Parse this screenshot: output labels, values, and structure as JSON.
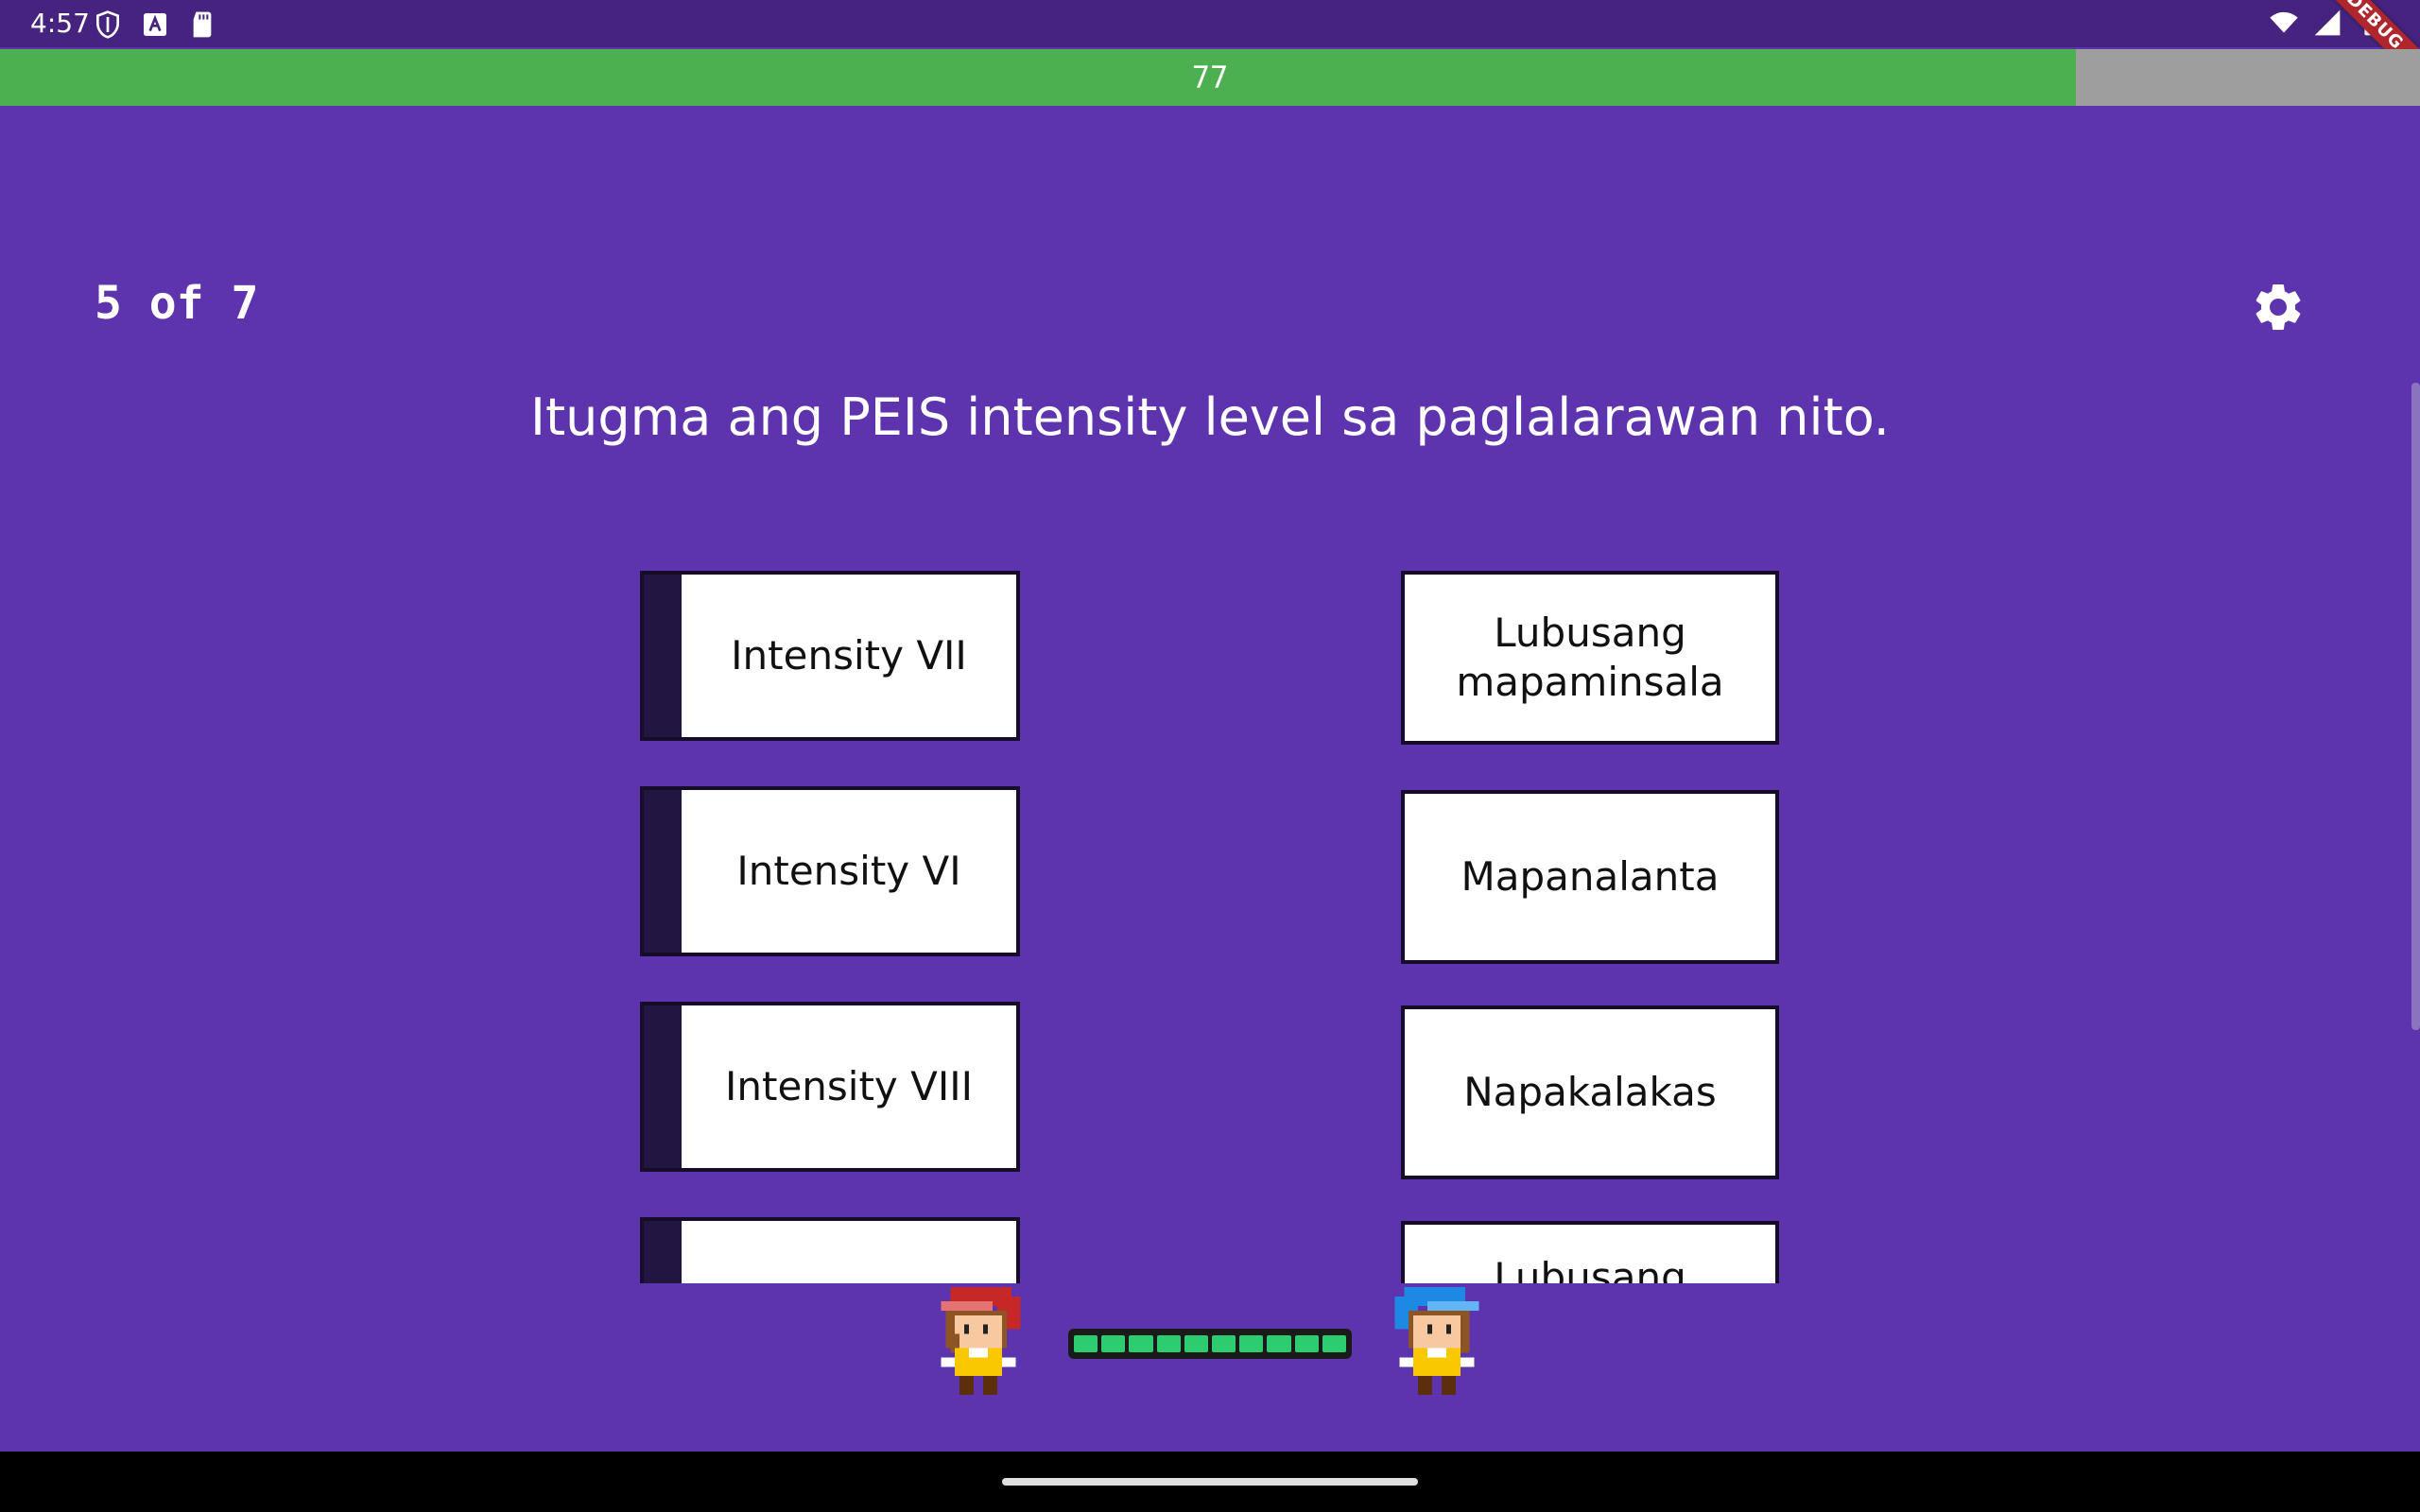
{
  "status_bar": {
    "time": "4:57",
    "left_icons": [
      "shield-icon",
      "a-letter-icon",
      "sd-card-icon"
    ],
    "right_icons": [
      "wifi-icon",
      "signal-icon",
      "battery-icon"
    ],
    "debug_label": "DEBUG"
  },
  "timer": {
    "value": "77",
    "fill_fraction": 0.858,
    "fill_color": "#4caf50"
  },
  "progress": {
    "text": "5 of 7"
  },
  "settings": {
    "icon": "gear-icon"
  },
  "question": "Itugma ang PEIS intensity level sa paglalarawan nito.",
  "left_cards": [
    {
      "label": "Intensity VII"
    },
    {
      "label": "Intensity VI"
    },
    {
      "label": "Intensity VIII"
    },
    {
      "label": ""
    }
  ],
  "right_cards": [
    {
      "label": "Lubusang mapaminsala"
    },
    {
      "label": "Mapanalanta"
    },
    {
      "label": "Napakalakas"
    },
    {
      "label": "Lubusang"
    }
  ],
  "battle": {
    "hp_segments": 10,
    "player_character": "red-cap-character",
    "opponent_character": "blue-cap-character"
  },
  "colors": {
    "background": "#5e33ae",
    "status_bar": "#45237e",
    "card_handle": "#221541",
    "hp": "#2ecc71"
  }
}
